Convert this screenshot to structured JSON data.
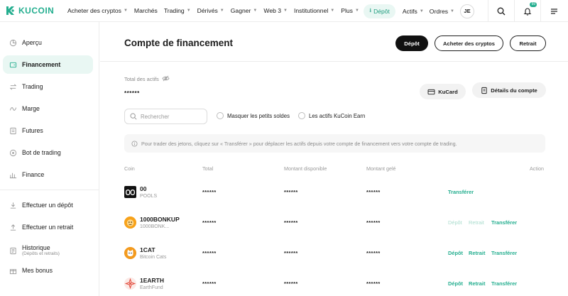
{
  "brand": {
    "name": "KUCOIN",
    "accent": "#24ae8f"
  },
  "nav": {
    "items": [
      {
        "label": "Acheter des cryptos",
        "dropdown": true
      },
      {
        "label": "Marchés",
        "dropdown": false
      },
      {
        "label": "Trading",
        "dropdown": true
      },
      {
        "label": "Dérivés",
        "dropdown": true
      },
      {
        "label": "Gagner",
        "dropdown": true
      },
      {
        "label": "Web 3",
        "dropdown": true
      },
      {
        "label": "Institutionnel",
        "dropdown": true
      },
      {
        "label": "Plus",
        "dropdown": true
      }
    ],
    "deposit": "Dépôt",
    "assets": "Actifs",
    "orders": "Ordres",
    "avatar_initials": "JE",
    "notification_count": "99"
  },
  "sidebar": {
    "items": [
      {
        "label": "Aperçu",
        "icon": "pie-icon",
        "active": false
      },
      {
        "label": "Financement",
        "icon": "wallet-icon",
        "active": true
      },
      {
        "label": "Trading",
        "icon": "swap-icon",
        "active": false
      },
      {
        "label": "Marge",
        "icon": "margin-icon",
        "active": false
      },
      {
        "label": "Futures",
        "icon": "futures-icon",
        "active": false
      },
      {
        "label": "Bot de trading",
        "icon": "bot-icon",
        "active": false
      },
      {
        "label": "Finance",
        "icon": "finance-icon",
        "active": false
      }
    ],
    "items2": [
      {
        "label": "Effectuer un dépôt",
        "icon": "deposit-icon"
      },
      {
        "label": "Effectuer un retrait",
        "icon": "withdraw-icon"
      },
      {
        "label": "Historique",
        "sub": "(Dépôts et retraits)",
        "icon": "history-icon"
      },
      {
        "label": "Mes bonus",
        "icon": "bonus-icon"
      }
    ]
  },
  "main": {
    "title": "Compte de financement",
    "btn_deposit": "Dépôt",
    "btn_buy": "Acheter des cryptos",
    "btn_withdraw": "Retrait",
    "total_label": "Total des actifs",
    "total_value": "******",
    "kucard": "KuCard",
    "account_details": "Détails du compte",
    "search_placeholder": "Rechercher",
    "hide_small": "Masquer les petits soldes",
    "earn_assets": "Les actifs KuCoin Earn",
    "info_text": "Pour trader des jetons, cliquez sur « Transférer » pour déplacer les actifs depuis votre compte de financement vers votre compte de trading."
  },
  "table": {
    "headers": {
      "coin": "Coin",
      "total": "Total",
      "available": "Montant disponible",
      "frozen": "Montant gelé",
      "action": "Action"
    },
    "rows": [
      {
        "symbol": "00",
        "name": "POOLS",
        "total": "******",
        "available": "******",
        "frozen": "******",
        "deposit": "",
        "withdraw": "",
        "transfer": "Transférer",
        "actions_enabled": true,
        "icon_bg": "#111111"
      },
      {
        "symbol": "1000BONKUP",
        "name": "1000BONK...",
        "total": "******",
        "available": "******",
        "frozen": "******",
        "deposit": "Dépôt",
        "withdraw": "Retrait",
        "transfer": "Transférer",
        "actions_enabled": false,
        "icon_bg": "#f7a21b"
      },
      {
        "symbol": "1CAT",
        "name": "Bitcoin Cats",
        "total": "******",
        "available": "******",
        "frozen": "******",
        "deposit": "Dépôt",
        "withdraw": "Retrait",
        "transfer": "Transférer",
        "actions_enabled": true,
        "icon_bg": "#f39a1e"
      },
      {
        "symbol": "1EARTH",
        "name": "EarthFund",
        "total": "******",
        "available": "******",
        "frozen": "******",
        "deposit": "Dépôt",
        "withdraw": "Retrait",
        "transfer": "Transférer",
        "actions_enabled": true,
        "icon_bg": "#fbe9e6"
      }
    ]
  }
}
